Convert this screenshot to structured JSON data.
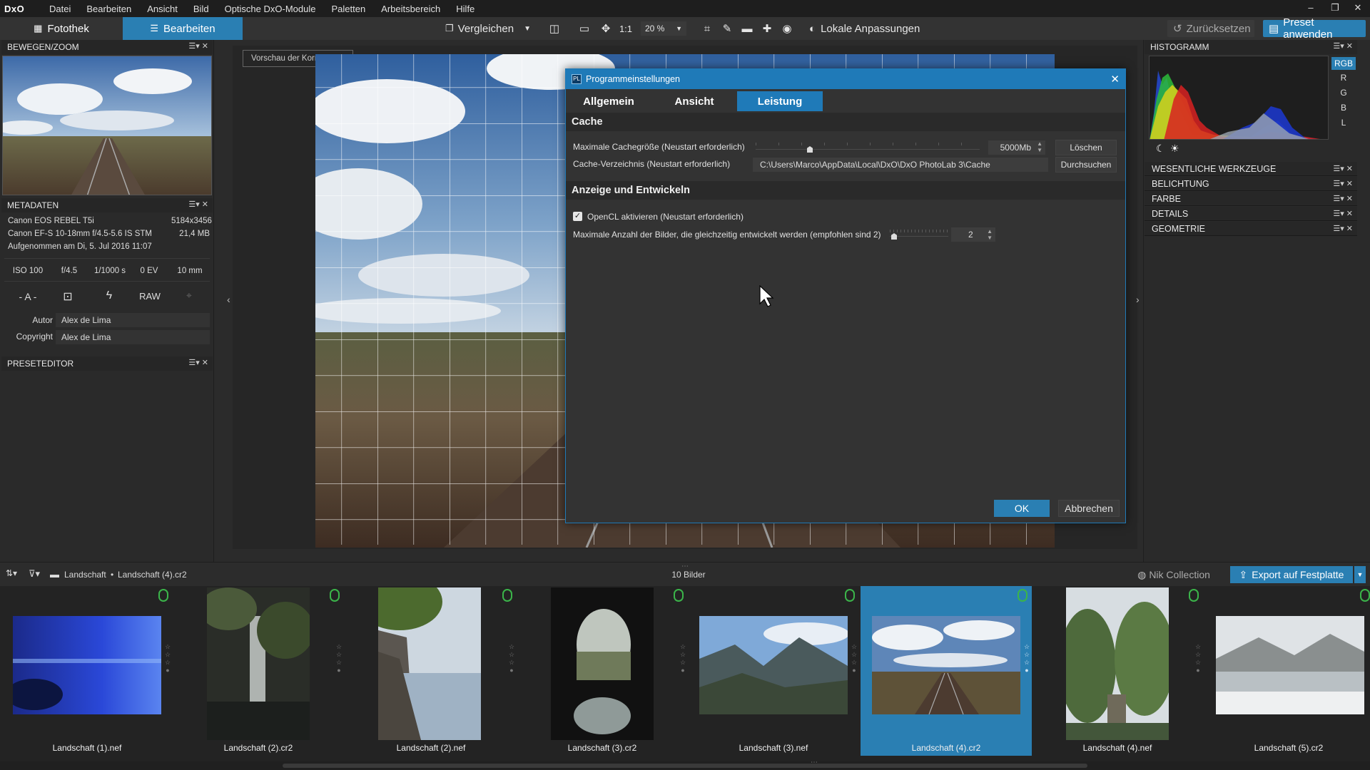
{
  "app": {
    "logo": "DxO",
    "menu": [
      "Datei",
      "Bearbeiten",
      "Ansicht",
      "Bild",
      "Optische DxO-Module",
      "Paletten",
      "Arbeitsbereich",
      "Hilfe"
    ],
    "window_controls": [
      "–",
      "❐",
      "✕"
    ]
  },
  "toolbar": {
    "tab_library": "Fotothek",
    "tab_edit": "Bearbeiten",
    "compare": "Vergleichen",
    "one_to_one": "1:1",
    "zoom": "20 %",
    "local_adjust": "Lokale Anpassungen",
    "reset": "Zurücksetzen",
    "apply_preset": "Preset anwenden"
  },
  "left": {
    "movezoom_title": "BEWEGEN/ZOOM",
    "metadata_title": "METADATEN",
    "camera": "Canon EOS REBEL T5i",
    "dimensions": "5184x3456",
    "lens": "Canon EF-S 10-18mm f/4.5-5.6 IS STM",
    "filesize": "21,4 MB",
    "captured": "Aufgenommen am Di, 5. Jul 2016 11:07",
    "exif": [
      "ISO 100",
      "f/4.5",
      "1/1000 s",
      "0 EV",
      "10 mm"
    ],
    "mode": "- A -",
    "raw": "RAW",
    "author_label": "Autor",
    "author_value": "Alex de Lima",
    "copyright_label": "Copyright",
    "copyright_value": "Alex de Lima",
    "preseteditor_title": "PRESETEDITOR",
    "panel_ctl": "☰▾ ✕"
  },
  "center": {
    "preview_button": "Vorschau der Korrekturen"
  },
  "dialog": {
    "title": "Programmeinstellungen",
    "tabs": [
      "Allgemein",
      "Ansicht",
      "Leistung"
    ],
    "cache_section": "Cache",
    "max_cache_label": "Maximale Cachegröße (Neustart erforderlich)",
    "max_cache_value": "5000Mb",
    "clear_button": "Löschen",
    "cache_dir_label": "Cache-Verzeichnis (Neustart erforderlich)",
    "cache_dir_value": "C:\\Users\\Marco\\AppData\\Local\\DxO\\DxO PhotoLab 3\\Cache",
    "browse_button": "Durchsuchen",
    "display_section": "Anzeige und Entwickeln",
    "opencl_label": "OpenCL aktivieren (Neustart erforderlich)",
    "opencl_checked": true,
    "max_images_label": "Maximale Anzahl der Bilder, die gleichzeitig entwickelt werden (empfohlen sind 2)",
    "max_images_value": "2",
    "ok_button": "OK",
    "cancel_button": "Abbrechen"
  },
  "right": {
    "histogram_title": "HISTOGRAMM",
    "channels": [
      "RGB",
      "R",
      "G",
      "B",
      "L"
    ],
    "tools": [
      "WESENTLICHE WERKZEUGE",
      "BELICHTUNG",
      "FARBE",
      "DETAILS",
      "GEOMETRIE"
    ]
  },
  "filmstrip": {
    "breadcrumb_root": "Landschaft",
    "breadcrumb_sep": "•",
    "breadcrumb_file": "Landschaft (4).cr2",
    "count": "10 Bilder",
    "nik": "Nik Collection",
    "export": "Export auf Festplatte",
    "items": [
      {
        "label": "Landschaft (1).nef",
        "selected": false
      },
      {
        "label": "Landschaft (2).cr2",
        "selected": false
      },
      {
        "label": "Landschaft (2).nef",
        "selected": false
      },
      {
        "label": "Landschaft (3).cr2",
        "selected": false
      },
      {
        "label": "Landschaft (3).nef",
        "selected": false
      },
      {
        "label": "Landschaft (4).cr2",
        "selected": true
      },
      {
        "label": "Landschaft (4).nef",
        "selected": false
      },
      {
        "label": "Landschaft (5).cr2",
        "selected": false
      }
    ]
  },
  "colors": {
    "accent": "#1f7ab8",
    "selected_thumb": "#2a7fb3",
    "panel_bg": "#2a2a2a",
    "pin_green": "#3bb44a"
  }
}
